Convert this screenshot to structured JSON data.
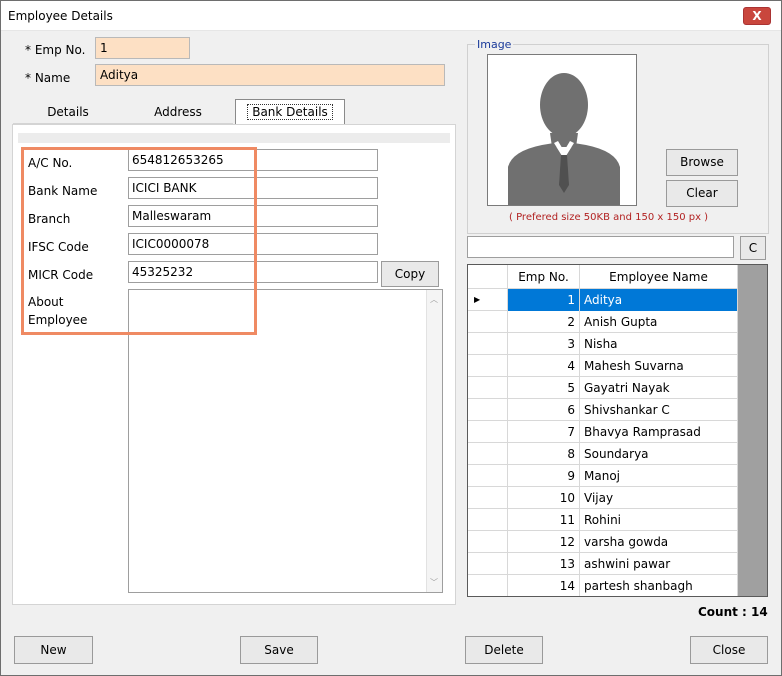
{
  "window": {
    "title": "Employee Details",
    "close_glyph": "X"
  },
  "header": {
    "emp_no_label": "* Emp No.",
    "emp_no_value": "1",
    "name_label": "* Name",
    "name_value": "Aditya"
  },
  "tabs": [
    {
      "label": "Details",
      "active": false
    },
    {
      "label": "Address",
      "active": false
    },
    {
      "label": "Bank Details",
      "active": true
    }
  ],
  "bank": {
    "ac_label": "A/C No.",
    "ac_value": "654812653265",
    "bank_label": "Bank Name",
    "bank_value": "ICICI BANK",
    "branch_label": "Branch",
    "branch_value": "Malleswaram",
    "ifsc_label": "IFSC Code",
    "ifsc_value": "ICIC0000078",
    "micr_label": "MICR Code",
    "micr_value": "45325232",
    "copy_label": "Copy",
    "about_label_1": "About",
    "about_label_2": "Employee",
    "about_value": ""
  },
  "image_panel": {
    "group_label": "Image",
    "browse_label": "Browse",
    "clear_label": "Clear",
    "hint": "( Prefered size 50KB and 150 x 150 px )"
  },
  "search": {
    "value": "",
    "clear_label": "C"
  },
  "grid": {
    "col_no": "Emp No.",
    "col_name": "Employee Name",
    "rows": [
      {
        "no": "1",
        "name": "Aditya"
      },
      {
        "no": "2",
        "name": "Anish Gupta"
      },
      {
        "no": "3",
        "name": "Nisha"
      },
      {
        "no": "4",
        "name": "Mahesh Suvarna"
      },
      {
        "no": "5",
        "name": "Gayatri Nayak"
      },
      {
        "no": "6",
        "name": "Shivshankar C"
      },
      {
        "no": "7",
        "name": "Bhavya Ramprasad"
      },
      {
        "no": "8",
        "name": "Soundarya"
      },
      {
        "no": "9",
        "name": "Manoj"
      },
      {
        "no": "10",
        "name": "Vijay"
      },
      {
        "no": "11",
        "name": "Rohini"
      },
      {
        "no": "12",
        "name": "varsha gowda"
      },
      {
        "no": "13",
        "name": "ashwini pawar"
      },
      {
        "no": "14",
        "name": "partesh shanbagh"
      }
    ],
    "selected_index": 0
  },
  "count_text": "Count : 14",
  "footer": {
    "new_label": "New",
    "save_label": "Save",
    "delete_label": "Delete",
    "close_label": "Close"
  },
  "colors": {
    "required_field": "#fde0c4",
    "selection": "#0078d7",
    "highlight_box": "#ef8a63",
    "hint_text": "#b22222",
    "group_label": "#1a3a9a"
  }
}
